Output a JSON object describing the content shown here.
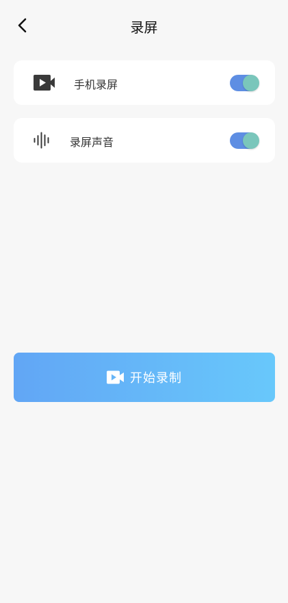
{
  "header": {
    "title": "录屏",
    "back_icon": "chevron-left-icon"
  },
  "settings": [
    {
      "label": "手机录屏",
      "icon": "video-recorder-icon",
      "enabled": true
    },
    {
      "label": "录屏声音",
      "icon": "sound-wave-icon",
      "enabled": true
    }
  ],
  "start_button": {
    "label": "开始录制",
    "icon": "video-camera-icon"
  },
  "colors": {
    "background": "#f7f7f7",
    "card": "#ffffff",
    "toggle_track": "#5e8ee3",
    "toggle_knob": "#7ac6bb",
    "button_gradient_start": "#62a6f5",
    "button_gradient_end": "#68c8fb"
  }
}
